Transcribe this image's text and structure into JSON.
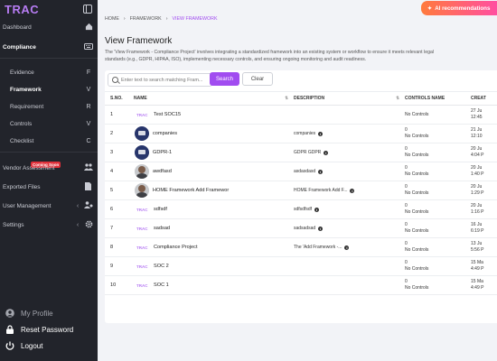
{
  "app": {
    "brand": "TRAC"
  },
  "sidebar": {
    "dashboard": "Dashboard",
    "compliance": "Compliance",
    "sub_items": [
      {
        "label": "Evidence",
        "key": "F"
      },
      {
        "label": "Framework",
        "key": "V"
      },
      {
        "label": "Requirement",
        "key": "R"
      },
      {
        "label": "Controls",
        "key": "V"
      },
      {
        "label": "Checklist",
        "key": "C"
      }
    ],
    "vendor_assessment": "Vendor Assessment",
    "coming_soon": "Coming Soon",
    "exported_files": "Exported Files",
    "user_management": "User Management",
    "settings": "Settings",
    "my_profile": "My Profile",
    "reset_password": "Reset Password",
    "logout": "Logout"
  },
  "header": {
    "ai_button": "AI recommendations",
    "breadcrumb": [
      "HOME",
      "FRAMEWORK",
      "VIEW FRAMEWORK"
    ],
    "title": "View Framework",
    "description_line1": "The 'View Framework - Compliance Project' involves integrating a standardized framework into an existing system or workflow to ensure it meets relevant legal",
    "description_line2": "standards (e.g., GDPR, HIPAA, ISO), implementing necessary controls, and ensuring ongoing monitoring and audit readiness."
  },
  "search": {
    "placeholder": "Enter text to search matching Fram...",
    "search_label": "Search",
    "clear_label": "Clear"
  },
  "table": {
    "headers": {
      "sno": "S.NO.",
      "name": "NAME",
      "description": "DESCRIPTION",
      "controls": "CONTROLS NAME",
      "created": "CREAT"
    },
    "rows": [
      {
        "sno": "1",
        "logo": "trac",
        "name": "Test SOC15",
        "description": "",
        "controls_count": "",
        "controls": "No Controls",
        "date1": "27 Ju",
        "date2": "12:45"
      },
      {
        "sno": "2",
        "logo": "org",
        "name": "companies",
        "description": "companies",
        "controls_count": "0",
        "controls": "No Controls",
        "date1": "21 Ju",
        "date2": "12:10"
      },
      {
        "sno": "3",
        "logo": "org",
        "name": "GDPR-1",
        "description": "GDPR GDPR",
        "controls_count": "0",
        "controls": "No Controls",
        "date1": "20 Ju",
        "date2": "4:04 P"
      },
      {
        "sno": "4",
        "logo": "person",
        "name": "awdfasd",
        "description": "asdasdasd",
        "controls_count": "0",
        "controls": "No Controls",
        "date1": "20 Ju",
        "date2": "1:40 P"
      },
      {
        "sno": "5",
        "logo": "person",
        "name": "HOME Framework Add Framewor",
        "description": "HOME Framework Add F...",
        "controls_count": "0",
        "controls": "No Controls",
        "date1": "20 Ju",
        "date2": "1:29 P"
      },
      {
        "sno": "6",
        "logo": "trac",
        "name": "sdfsdf",
        "description": "sdfsdfsdf",
        "controls_count": "0",
        "controls": "No Controls",
        "date1": "20 Ju",
        "date2": "1:16 P"
      },
      {
        "sno": "7",
        "logo": "trac",
        "name": "sadsad",
        "description": "sadsadsad",
        "controls_count": "0",
        "controls": "No Controls",
        "date1": "16 Ju",
        "date2": "6:19 P"
      },
      {
        "sno": "8",
        "logo": "trac",
        "name": "Compliance Project",
        "description": "The 'Add Framework -...",
        "controls_count": "0",
        "controls": "No Controls",
        "date1": "13 Ju",
        "date2": "5:56 P"
      },
      {
        "sno": "9",
        "logo": "trac",
        "name": "SOC 2",
        "description": "",
        "controls_count": "0",
        "controls": "No Controls",
        "date1": "15 Ma",
        "date2": "4:49 P"
      },
      {
        "sno": "10",
        "logo": "trac",
        "name": "SOC 1",
        "description": "",
        "controls_count": "0",
        "controls": "No Controls",
        "date1": "15 Ma",
        "date2": "4:49 P"
      }
    ]
  },
  "colors": {
    "accent": "#a14cf0",
    "sidebar_bg": "#22242b",
    "ai_gradient_start": "#ff7a3d",
    "ai_gradient_end": "#ff4fa0"
  }
}
